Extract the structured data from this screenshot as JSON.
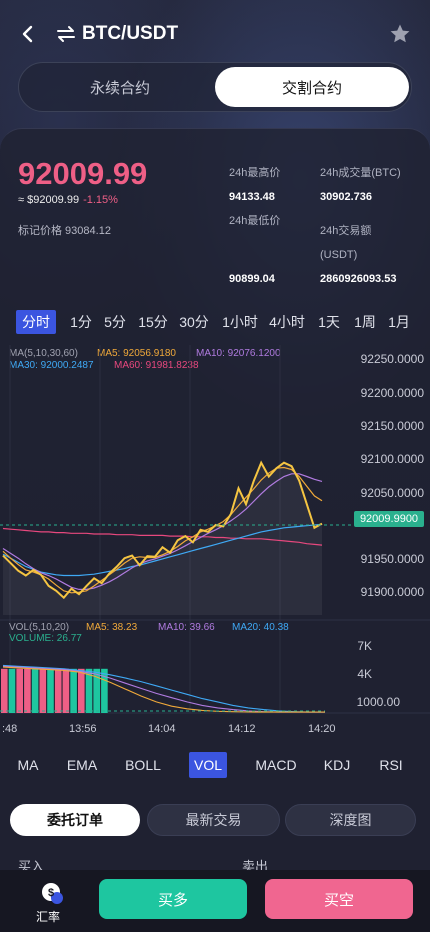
{
  "header": {
    "pair": "BTC/USDT",
    "back_icon": "chevron-left-icon",
    "swap_icon": "swap-arrows-icon",
    "favorite_icon": "star-icon"
  },
  "segment": {
    "tabs": [
      "永续合约",
      "交割合约"
    ],
    "active": "交割合约"
  },
  "ticker": {
    "last_price": "92009.99",
    "approx_value": "≈ $92009.99",
    "change": "-1.15%",
    "mark_price": "标记价格 93084.12",
    "stats": {
      "high_label": "24h最高价",
      "high_value": "94133.48",
      "low_label": "24h最低价",
      "low_value": "90899.04",
      "vol_label": "24h成交量(BTC)",
      "vol_value": "30902.736",
      "amount_label_1": "24h交易额",
      "amount_label_2": "(USDT)",
      "amount_value": "2860926093.53"
    }
  },
  "periods": {
    "items": [
      "分时",
      "1分",
      "5分",
      "15分",
      "30分",
      "1小时",
      "4小时",
      "1天",
      "1周",
      "1月"
    ],
    "active": "分时"
  },
  "ma_legend": {
    "line1_prefix": "MA(5,10,30,60)",
    "ma5": "MA5: 92056.9180",
    "ma10": "MA10: 92076.1200",
    "ma30": "MA30: 92000.2487",
    "ma60": "MA60: 91981.8238"
  },
  "price_axis": [
    "92250.0000",
    "92200.0000",
    "92150.0000",
    "92100.0000",
    "92050.0000",
    "91950.0000",
    "91900.0000"
  ],
  "current_price_tag": "92009.9900",
  "vol_legend": {
    "title": "VOL(5,10,20)",
    "ma5": "MA5: 38.23",
    "ma10": "MA10: 39.66",
    "ma20": "MA20: 40.38",
    "volume": "VOLUME: 26.77"
  },
  "volume_axis": [
    "7K",
    "4K",
    "1000.00"
  ],
  "time_axis": [
    ":48",
    "13:56",
    "14:04",
    "14:12",
    "14:20"
  ],
  "indicators": {
    "items": [
      "MA",
      "EMA",
      "BOLL",
      "VOL",
      "MACD",
      "KDJ",
      "RSI"
    ],
    "active": "VOL"
  },
  "order_tabs": {
    "items": [
      "委托订单",
      "最新交易",
      "深度图"
    ],
    "active": "委托订单"
  },
  "order_book": {
    "buy_label": "买入",
    "sell_label": "卖出"
  },
  "bottom": {
    "rate_label": "汇率",
    "rate_icon": "dollar-coin-icon",
    "buy_button": "买多",
    "sell_button": "买空"
  },
  "colors": {
    "up_red": "#ee5f86",
    "down_green": "#1ec6a0",
    "accent_blue": "#3b55e0",
    "price_line": "#f5c542",
    "ma5": "#f0a93a",
    "ma10": "#b07be0",
    "ma30": "#3fa9f5",
    "ma60": "#e8487e"
  },
  "chart_data": {
    "type": "line",
    "price_series": [
      91966,
      91955,
      91944,
      91937,
      91945,
      91938,
      91922,
      91915,
      91905,
      91918,
      91910,
      91922,
      91933,
      91926,
      91940,
      91950,
      91962,
      91966,
      91952,
      91965,
      91964,
      91978,
      91970,
      91988,
      91994,
      91985,
      92003,
      92000,
      92010,
      92008,
      92026,
      92063,
      92040,
      92073,
      92100,
      92080,
      92092,
      92100,
      92095,
      92074,
      92040,
      92006,
      92012
    ],
    "ma5_series": [
      91972,
      91962,
      91953,
      91945,
      91942,
      91938,
      91932,
      91923,
      91915,
      91912,
      91913,
      91915,
      91922,
      91930,
      91938,
      91946,
      91955,
      91962,
      91964,
      91963,
      91963,
      91967,
      91972,
      91979,
      91987,
      91993,
      92000,
      92004,
      92009,
      92015,
      92025,
      92038,
      92050,
      92062,
      92075,
      92085,
      92092,
      92093,
      92090,
      92080,
      92066,
      92052,
      92045
    ],
    "ma10_series": [
      91976,
      91969,
      91962,
      91954,
      91947,
      91941,
      91937,
      91932,
      91926,
      91920,
      91917,
      91917,
      91919,
      91923,
      91928,
      91934,
      91941,
      91948,
      91954,
      91958,
      91961,
      91965,
      91969,
      91974,
      91980,
      91986,
      91992,
      91998,
      92003,
      92009,
      92016,
      92024,
      92033,
      92044,
      92055,
      92065,
      92073,
      92080,
      92084,
      92084,
      92080,
      92076,
      92073
    ],
    "ma30_series": [
      91968,
      91962,
      91956,
      91950,
      91946,
      91942,
      91940,
      91938,
      91937,
      91937,
      91937,
      91938,
      91939,
      91941,
      91943,
      91945,
      91947,
      91950,
      91952,
      91955,
      91958,
      91961,
      91964,
      91967,
      91970,
      91973,
      91976,
      91979,
      91982,
      91985,
      91988,
      91991,
      91994,
      91997,
      92000,
      92002,
      92004,
      92006,
      92007,
      92008,
      92009,
      92010,
      92011
    ],
    "ma60_series": [
      92005,
      92004,
      92003,
      92002,
      92001,
      92000,
      92000,
      91999,
      91999,
      91998,
      91998,
      91998,
      91997,
      91997,
      91997,
      91996,
      91996,
      91996,
      91995,
      91995,
      91995,
      91995,
      91994,
      91994,
      91994,
      91993,
      91993,
      91993,
      91992,
      91992,
      91991,
      91991,
      91990,
      91990,
      91990,
      91989,
      91988,
      91987,
      91986,
      91985,
      91983,
      91982,
      91981
    ],
    "price_ylim": [
      91880,
      92270
    ],
    "volume_bars": [
      {
        "v": 5200,
        "up": false
      },
      {
        "v": 5200,
        "up": true
      },
      {
        "v": 5200,
        "up": false
      },
      {
        "v": 5200,
        "up": false
      },
      {
        "v": 5200,
        "up": true
      },
      {
        "v": 5200,
        "up": false
      },
      {
        "v": 5200,
        "up": true
      },
      {
        "v": 5200,
        "up": false
      },
      {
        "v": 5200,
        "up": false
      },
      {
        "v": 5200,
        "up": true
      },
      {
        "v": 5200,
        "up": false
      },
      {
        "v": 5200,
        "up": true
      },
      {
        "v": 5200,
        "up": true
      },
      {
        "v": 5200,
        "up": true
      }
    ],
    "vol_ma5": [
      5400,
      5300,
      5200,
      5100,
      5000,
      4800,
      4300,
      3600,
      2800,
      2000,
      1300,
      800,
      500,
      300,
      200,
      150,
      120,
      100,
      100,
      100,
      100,
      100
    ],
    "vol_ma10": [
      5500,
      5400,
      5300,
      5200,
      5100,
      4900,
      4600,
      4100,
      3500,
      2900,
      2300,
      1800,
      1300,
      900,
      600,
      400,
      250,
      150,
      100,
      100,
      100,
      100
    ],
    "vol_ma20": [
      5600,
      5500,
      5400,
      5300,
      5200,
      5000,
      4800,
      4500,
      4100,
      3700,
      3200,
      2700,
      2200,
      1700,
      1300,
      900,
      600,
      400,
      250,
      150,
      100,
      100
    ],
    "volume_ylim": [
      0,
      8000
    ],
    "last_price": 92009.99
  }
}
